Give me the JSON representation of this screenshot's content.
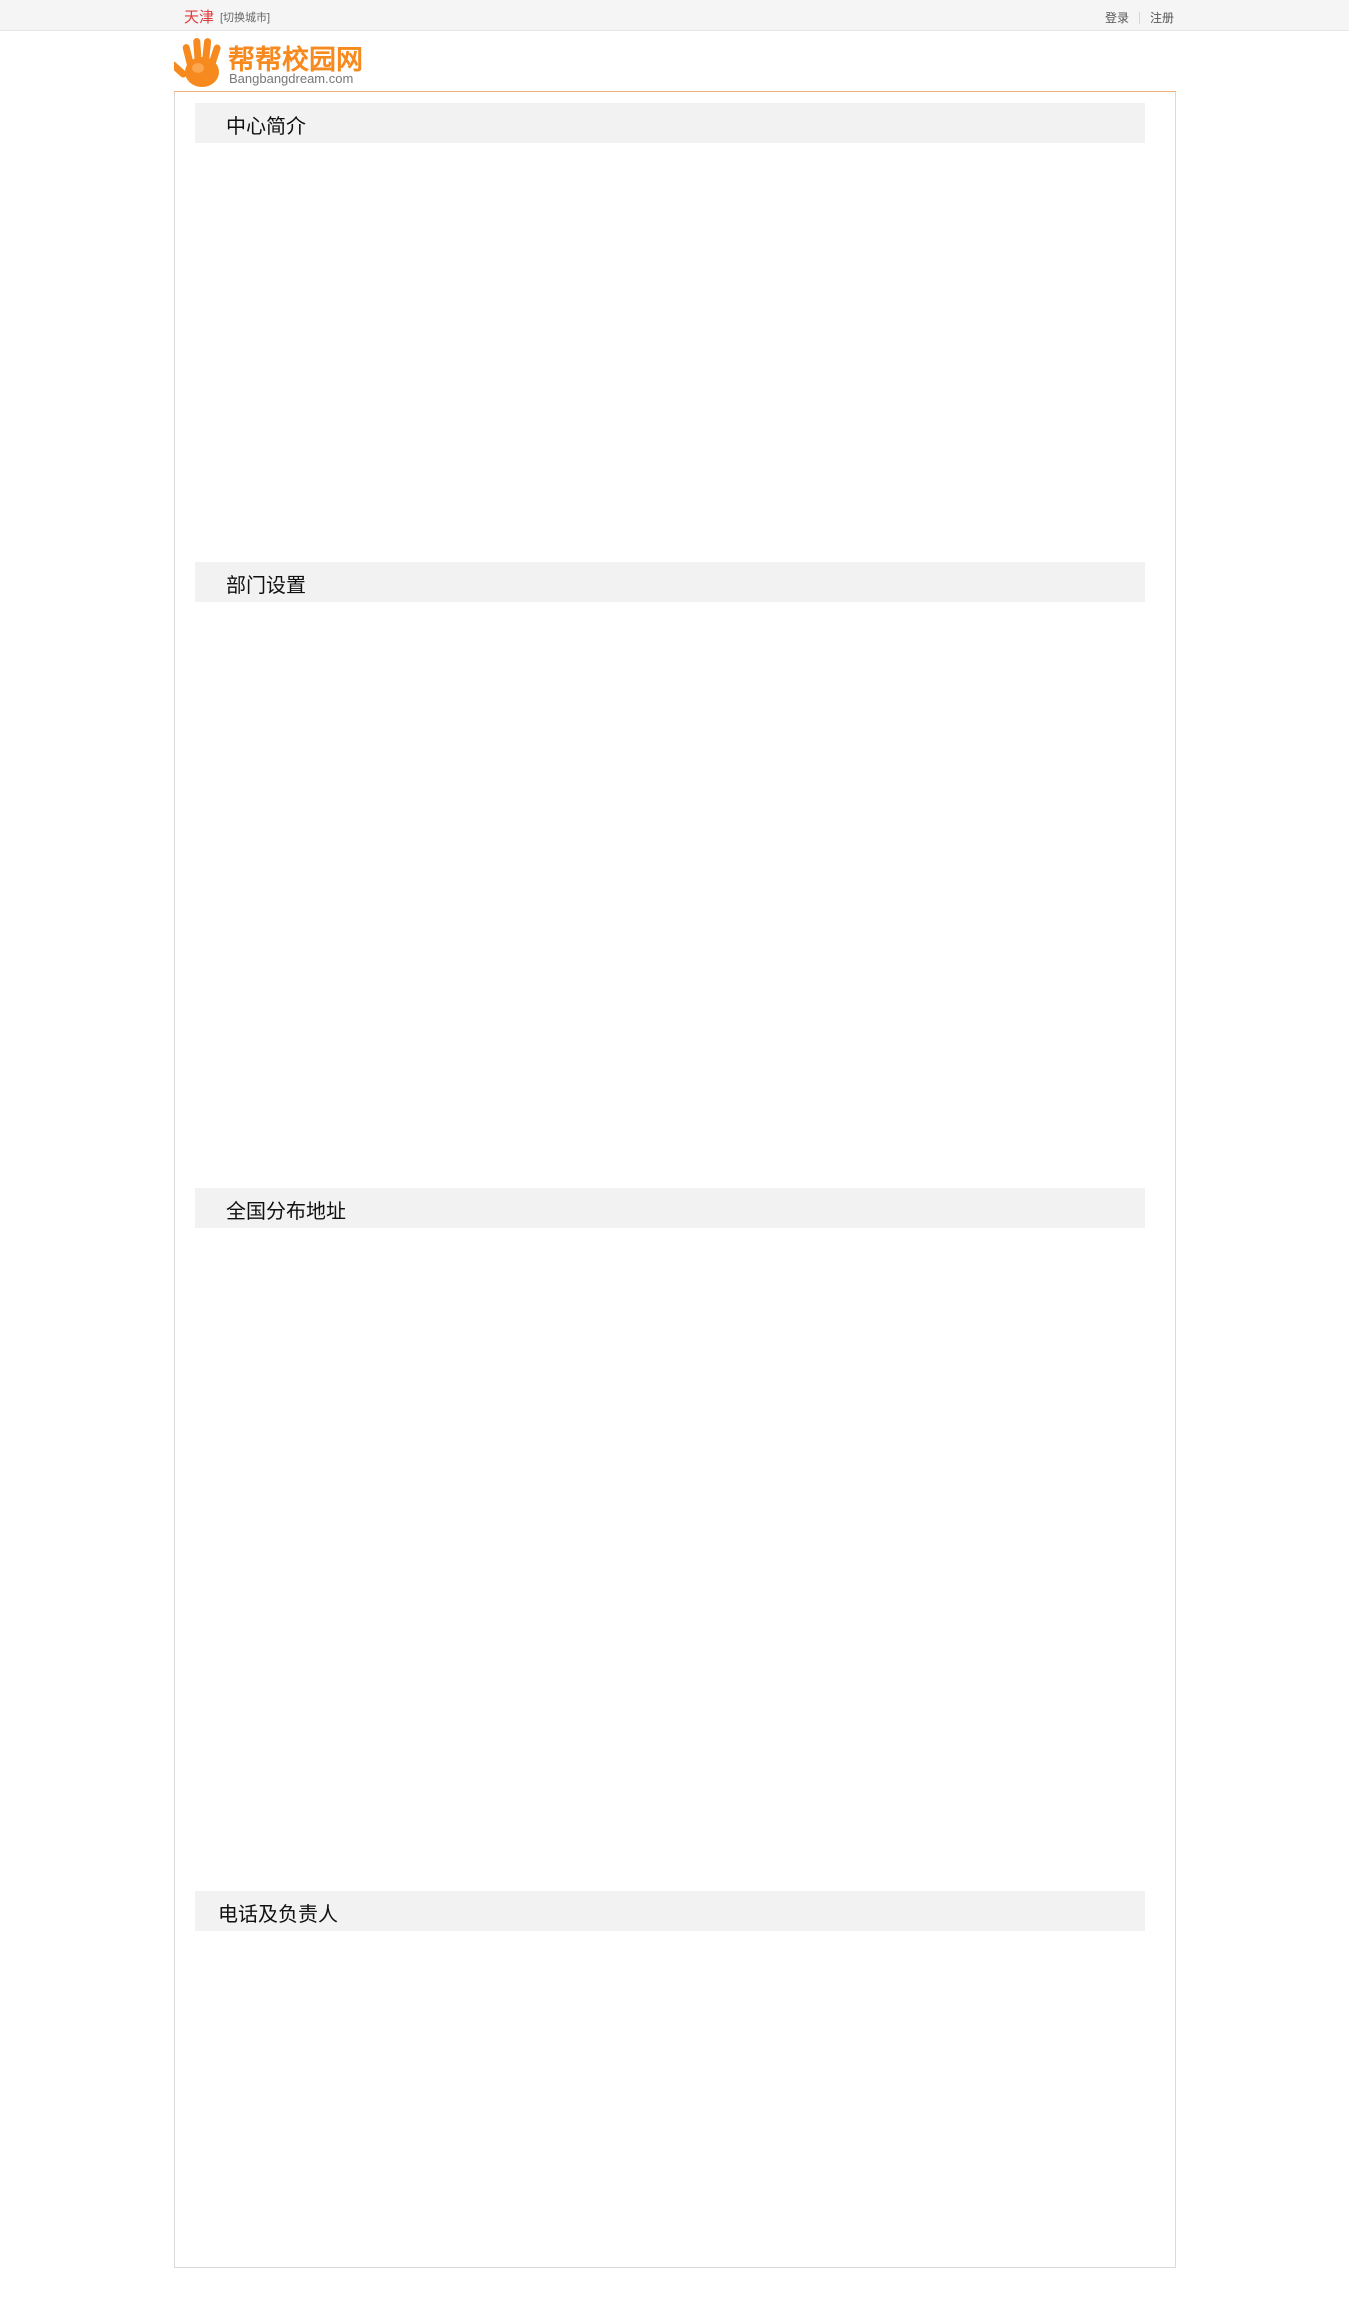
{
  "topbar": {
    "city": "天津",
    "switch_city": "[切换城市]",
    "login": "登录",
    "register": "注册"
  },
  "logo": {
    "name": "帮帮校园网",
    "domain": "Bangbangdream.com",
    "icon": "orange-hand-icon"
  },
  "colors": {
    "accent": "#f78a1e",
    "city": "#e4393c",
    "section_bg": "#f2f2f2"
  },
  "sections": [
    {
      "title": "中心简介"
    },
    {
      "title": "部门设置"
    },
    {
      "title": "全国分布地址"
    },
    {
      "title": "电话及负责人"
    }
  ]
}
